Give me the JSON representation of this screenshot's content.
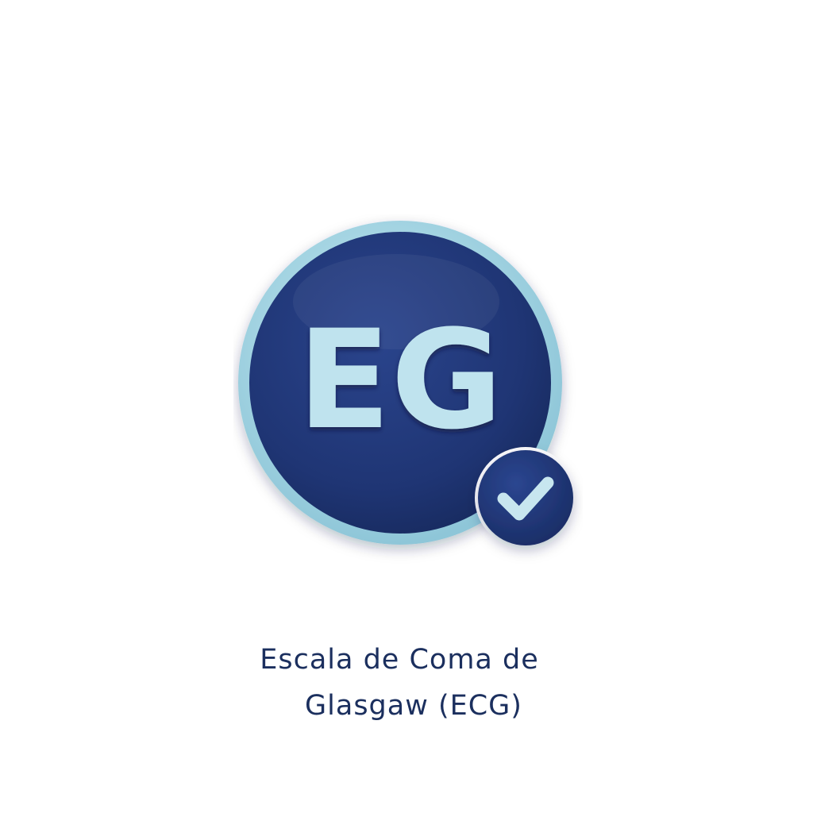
{
  "badge": {
    "initials": "EG",
    "icon": "check-icon",
    "colors": {
      "ring": "#a9d8e6",
      "disc": "#1e3472",
      "letters": "#bfe3ee",
      "check": "#c7e6ef"
    }
  },
  "caption": {
    "line1": "Escala de Coma de",
    "line2": "Glasgaw (ECG)",
    "color": "#1b2f5e"
  }
}
